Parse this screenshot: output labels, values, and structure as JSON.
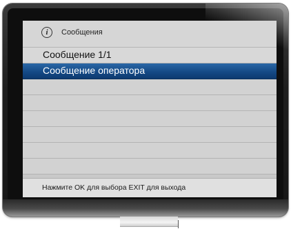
{
  "dialog": {
    "title": "Сообщения",
    "icon": "info-icon"
  },
  "list": {
    "items": [
      {
        "label": "Сообщение 1/1",
        "selected": false
      },
      {
        "label": "Сообщение оператора",
        "selected": true
      },
      {
        "label": "",
        "selected": false
      },
      {
        "label": "",
        "selected": false
      },
      {
        "label": "",
        "selected": false
      },
      {
        "label": "",
        "selected": false
      },
      {
        "label": "",
        "selected": false
      },
      {
        "label": "",
        "selected": false
      }
    ]
  },
  "footer": {
    "hint": "Нажмите OK для выбора EXIT для выхода"
  },
  "colors": {
    "selection": "#154a86",
    "screen_bg": "#d2d2d2",
    "bezel": "#1e1e1e"
  }
}
